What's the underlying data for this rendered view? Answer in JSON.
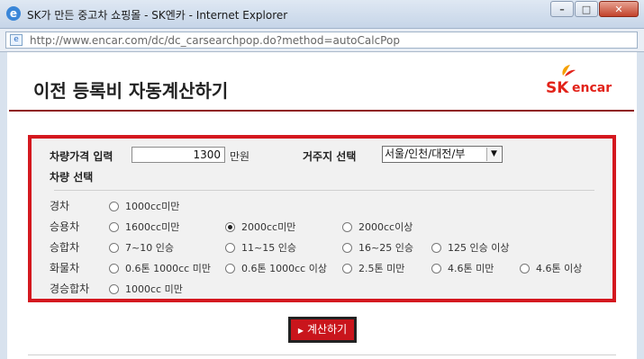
{
  "window": {
    "title": "SK가 만든 중고차 쇼핑몰 - SK엔카 - Internet Explorer",
    "url": "http://www.encar.com/dc/dc_carsearchpop.do?method=autoCalcPop",
    "buttons": {
      "minimize": "–",
      "maximize": "□",
      "close": "✕"
    }
  },
  "header": {
    "title": "이전 등록비 자동계산하기",
    "logo_sk": "SK",
    "logo_encar": "encar"
  },
  "form": {
    "price_label": "차량가격 입력",
    "price_value": "1300",
    "price_unit": "만원",
    "region_label": "거주지 선택",
    "region_selected": "서울/인천/대전/부",
    "vehicle_label": "차량 선택",
    "rows": [
      {
        "label": "경차",
        "options": [
          "1000cc미만"
        ]
      },
      {
        "label": "승용차",
        "options": [
          "1600cc미만",
          "2000cc미만",
          "2000cc이상"
        ]
      },
      {
        "label": "승합차",
        "options": [
          "7~10 인승",
          "11~15 인승",
          "16~25 인승",
          "125 인승 이상"
        ]
      },
      {
        "label": "화물차",
        "options": [
          "0.6톤 1000cc 미만",
          "0.6톤 1000cc 이상",
          "2.5톤 미만",
          "4.6톤 미만",
          "4.6톤 이상"
        ]
      },
      {
        "label": "경승합차",
        "options": [
          "1000cc 미만"
        ]
      }
    ],
    "selected": "2000cc미만"
  },
  "actions": {
    "calculate_label": "계산하기"
  },
  "colors": {
    "accent": "#d4181f",
    "header_line": "#8f1c1c"
  }
}
